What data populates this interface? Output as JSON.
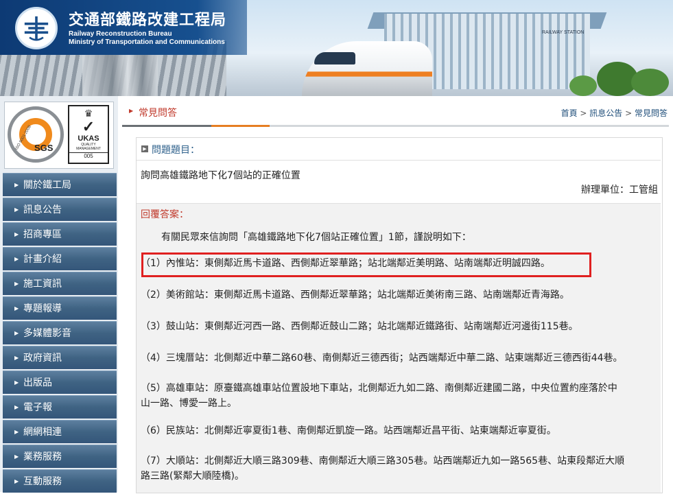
{
  "header": {
    "title_cn": "交通部鐵路改建工程局",
    "title_en_1": "Railway Reconstruction Bureau",
    "title_en_2": "Ministry of Transportation and Communications",
    "station_sign": "RAILWAY STATION"
  },
  "certs": {
    "iso_text": "ISO 9001:2008",
    "sgs": "SGS",
    "ukas": "UKAS",
    "ukas_sub": "QUALITY MANAGEMENT",
    "ukas_no": "005"
  },
  "sidebar": {
    "items": [
      {
        "label": "關於鐵工局"
      },
      {
        "label": "訊息公告"
      },
      {
        "label": "招商專區"
      },
      {
        "label": "計畫介紹"
      },
      {
        "label": "施工資訊"
      },
      {
        "label": "專題報導"
      },
      {
        "label": "多媒體影音"
      },
      {
        "label": "政府資訊"
      },
      {
        "label": "出版品"
      },
      {
        "label": "電子報"
      },
      {
        "label": "網網相連"
      },
      {
        "label": "業務服務"
      },
      {
        "label": "互動服務"
      }
    ]
  },
  "main": {
    "section_title": "常見問答",
    "breadcrumb": {
      "home": "首頁",
      "sep1": " > ",
      "level1": "訊息公告",
      "sep2": " > ",
      "current": "常見問答"
    },
    "question_label": "問題題目：",
    "question_text": "詢問高雄鐵路地下化7個站的正確位置",
    "department": "辦理單位：工管組",
    "answer_label": "回覆答案：",
    "answer_intro": "有關民眾來信詢問「高雄鐵路地下化7個站正確位置」1節，謹說明如下：",
    "answer_items": [
      "（1）內惟站：東側鄰近馬卡道路、西側鄰近翠華路；站北端鄰近美明路、站南端鄰近明誠四路。",
      "（2）美術館站：東側鄰近馬卡道路、西側鄰近翠華路；站北端鄰近美術南三路、站南端鄰近青海路。",
      "（3）鼓山站：東側鄰近河西一路、西側鄰近鼓山二路；站北端鄰近鐵路街、站南端鄰近河邊街115巷。",
      "（4）三塊厝站：北側鄰近中華二路60巷、南側鄰近三德西街；站西端鄰近中華二路、站東端鄰近三德西街44巷。",
      "（5）高雄車站：原臺鐵高雄車站位置設地下車站，北側鄰近九如二路、南側鄰近建國二路，中央位置約座落於中",
      "山一路、博愛一路上。",
      "（6）民族站：北側鄰近寧夏街1巷、南側鄰近凱旋一路。站西端鄰近昌平街、站東端鄰近寧夏街。",
      "（7）大順站：北側鄰近大順三路309巷、南側鄰近大順三路305巷。站西端鄰近九如一路565巷、站東段鄰近大順",
      "路三路(緊鄰大順陸橋)。"
    ]
  },
  "colors": {
    "accent_red": "#c0392b",
    "highlight_border": "#e02020",
    "nav_blue": "#3f6383",
    "tab_orange": "#e67e22"
  }
}
